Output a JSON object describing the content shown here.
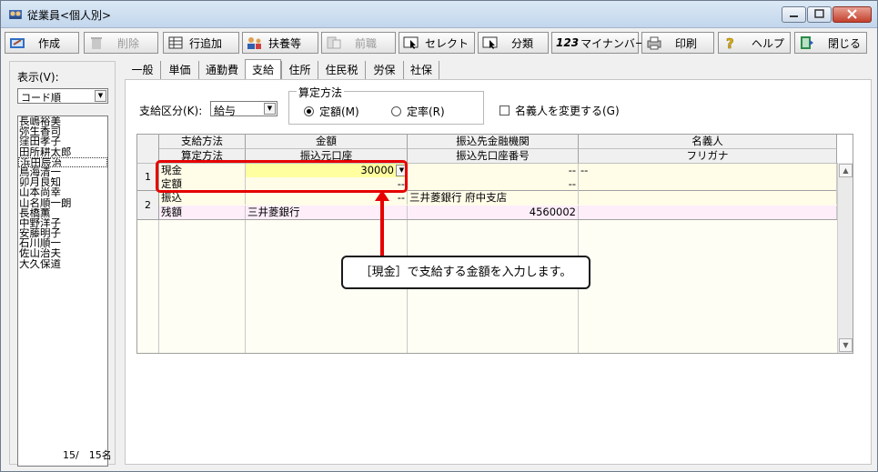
{
  "window": {
    "title": "従業員<個人別>"
  },
  "toolbar": {
    "buttons": [
      {
        "label": "作成",
        "icon": "create-icon"
      },
      {
        "label": "削除",
        "icon": "delete-icon",
        "disabled": true
      },
      {
        "label": "行追加",
        "icon": "add-row-icon"
      },
      {
        "label": "扶養等",
        "icon": "dependents-icon"
      },
      {
        "label": "前職",
        "icon": "previous-job-icon",
        "disabled": true
      },
      {
        "label": "セレクト",
        "icon": "select-icon"
      },
      {
        "label": "分類",
        "icon": "classify-icon"
      },
      {
        "label": "マイナンバー",
        "icon": "mynumber-icon",
        "prefix": "123"
      },
      {
        "label": "印刷",
        "icon": "print-icon"
      },
      {
        "label": "ヘルプ",
        "icon": "help-icon"
      },
      {
        "label": "閉じる",
        "icon": "close-book-icon"
      }
    ]
  },
  "left_panel": {
    "display_label": "表示(V):",
    "sort_value": "コード順",
    "names": [
      "長嶋裕美",
      "弥生香司",
      "窪田孝子",
      "田所耕太郎",
      "浜田辰治",
      "鳥海清一",
      "卯月良知",
      "山本尚幸",
      "山名順一朗",
      "長橋薫",
      "中野洋子",
      "安藤明子",
      "石川順一",
      "佐山治夫",
      "大久保道"
    ],
    "selected_index": 4,
    "count": "15/　15名"
  },
  "tabs": [
    "一般",
    "単価",
    "通勤費",
    "支給",
    "住所",
    "住民税",
    "労保",
    "社保"
  ],
  "active_tab": 3,
  "form": {
    "pay_class_label": "支給区分(K):",
    "pay_class_value": "給与",
    "calc_method_title": "算定方法",
    "radio_fixed": "定額(M)",
    "radio_rate": "定率(R)",
    "change_name_label": "名義人を変更する(G)"
  },
  "grid": {
    "headers_top": [
      "支給方法",
      "金額",
      "振込先金融機関",
      "名義人"
    ],
    "headers_bottom": [
      "算定方法",
      "振込元口座",
      "振込先口座番号",
      "フリガナ"
    ],
    "rows": [
      {
        "num": "1",
        "line1": {
          "method": "現金",
          "amount": "30000",
          "bank": "--",
          "holder": "--"
        },
        "line2": {
          "method": "定額",
          "amount": "--",
          "bank": "--",
          "holder": ""
        }
      },
      {
        "num": "2",
        "line1": {
          "method": "振込",
          "amount": "--",
          "bank": "三井菱銀行 府中支店",
          "holder": ""
        },
        "line2": {
          "method": "残額",
          "amount": "三井菱銀行",
          "bank": "4560002",
          "holder": ""
        }
      }
    ]
  },
  "callout": {
    "text": "［現金］で支給する金額を入力します。"
  },
  "colors": {
    "highlight": "#e60000",
    "edit_cell": "#ffffa0",
    "row_yellow": "#fffce8",
    "row_pink": "#fdeefa"
  }
}
